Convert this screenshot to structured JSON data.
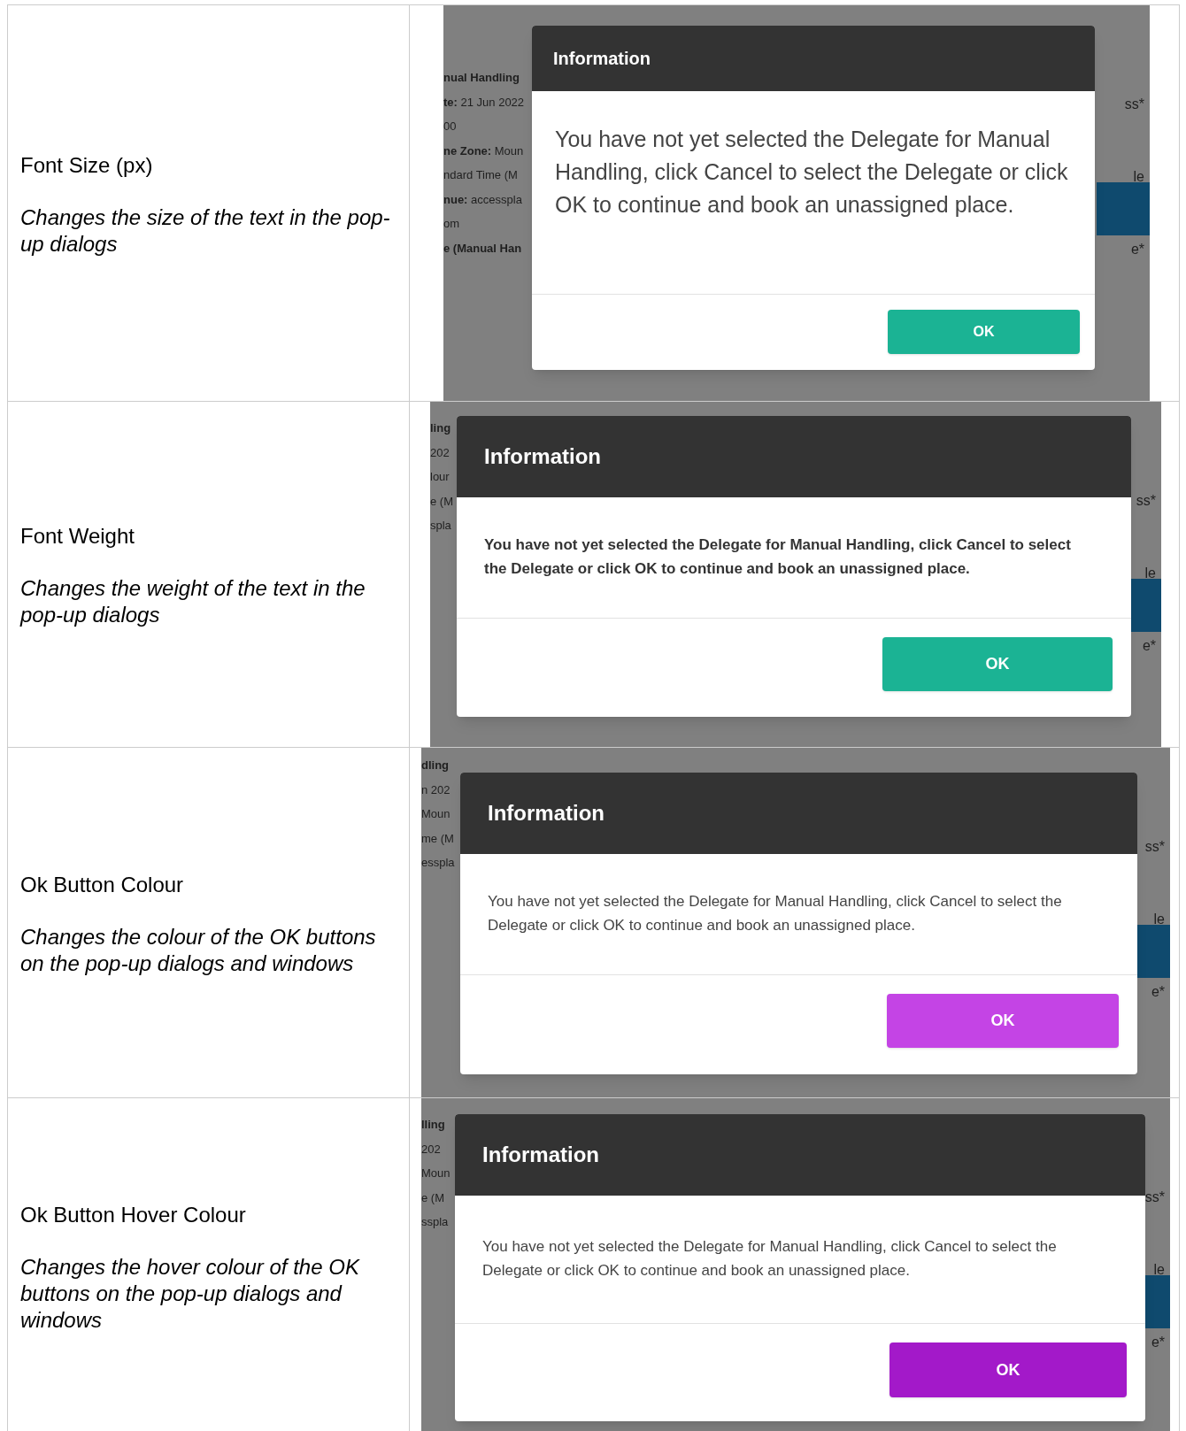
{
  "rows": [
    {
      "label": "Font Size (px)",
      "description": "Changes the size of the text in the pop-up dialogs",
      "preview": {
        "left_fragments": [
          "**nual Handling**",
          "**te:** 21 Jun 2022",
          "00",
          "**ne Zone:** Moun",
          "ndard Time (M",
          "**nue:** accesspla",
          "om",
          "**e (Manual Han**"
        ],
        "right_fragments": [
          "ss*",
          "le",
          "e*"
        ],
        "dialog": {
          "title": "Information",
          "message": "You have not yet selected the Delegate for Manual Handling, click Cancel to select the Delegate or click OK to continue and book an unassigned place.",
          "kind": "large",
          "ok_button": {
            "label": "OK",
            "color": "#1bb394"
          }
        }
      }
    },
    {
      "label": "Font Weight",
      "description": "Changes the weight of the text in the pop-up dialogs",
      "preview": {
        "left_fragments": [
          "**ling**",
          "202",
          "lour",
          "e (M",
          "spla"
        ],
        "right_fragments": [
          "ss*",
          "le",
          "e*"
        ],
        "dialog": {
          "title": "Information",
          "message": "You have not yet selected the Delegate for Manual Handling, click Cancel to select the Delegate or click OK to continue and book an unassigned place.",
          "kind": "bold",
          "ok_button": {
            "label": "OK",
            "color": "#1bb394"
          }
        }
      }
    },
    {
      "label": "Ok Button Colour",
      "description": "Changes the colour of the OK buttons on the pop-up dialogs and windows",
      "preview": {
        "left_fragments": [
          "**dling**",
          "n 202",
          "Moun",
          "me (M",
          "esspla"
        ],
        "right_fragments": [
          "ss*",
          "le",
          "e*"
        ],
        "dialog": {
          "title": "Information",
          "message": "You have not yet selected the Delegate for Manual Handling, click Cancel to select the Delegate or click OK to continue and book an unassigned place.",
          "kind": "regular",
          "ok_button": {
            "label": "OK",
            "color": "#c444e5"
          }
        }
      }
    },
    {
      "label": "Ok Button Hover Colour",
      "description": "Changes the hover colour of the OK buttons on the pop-up dialogs and windows",
      "preview": {
        "left_fragments": [
          "**lling**",
          "202",
          "Moun",
          "e (M",
          "sspla"
        ],
        "right_fragments": [
          "ss*",
          "le",
          "e*"
        ],
        "dialog": {
          "title": "Information",
          "message": "You have not yet selected the Delegate for Manual Handling, click Cancel to select the Delegate or click OK to continue and book an unassigned place.",
          "kind": "regular",
          "ok_button": {
            "label": "OK",
            "color": "#a319c9"
          }
        }
      }
    }
  ]
}
